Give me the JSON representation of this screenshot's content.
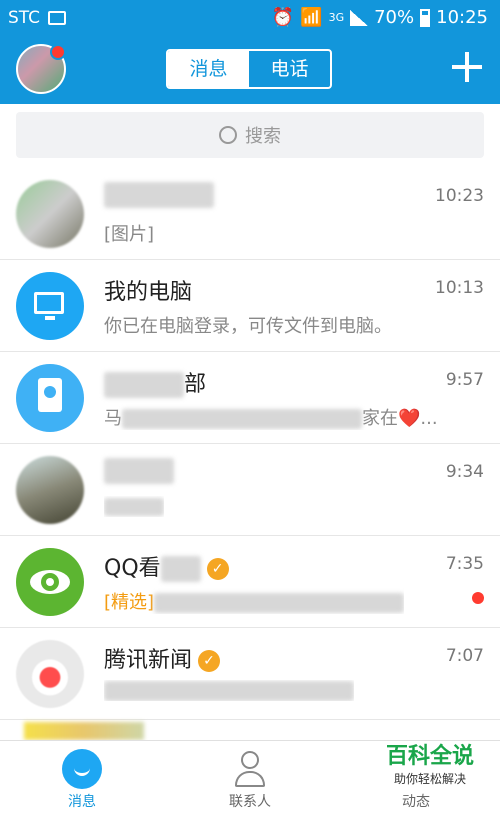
{
  "statusbar": {
    "carrier": "STC",
    "battery": "70%",
    "time": "10:25",
    "network": "3G"
  },
  "header": {
    "tab_messages": "消息",
    "tab_calls": "电话"
  },
  "search": {
    "placeholder": "搜索"
  },
  "chats": [
    {
      "name": "",
      "message": "[图片]",
      "time": "10:23"
    },
    {
      "name": "我的电脑",
      "message": "你已在电脑登录，可传文件到电脑。",
      "time": "10:13"
    },
    {
      "name": "部",
      "message": "马",
      "message_end": "家在❤️...",
      "time": "9:57"
    },
    {
      "name": "",
      "message": "",
      "time": "9:34"
    },
    {
      "name": "QQ看",
      "message": "[精选]",
      "time": "7:35"
    },
    {
      "name": "腾讯新闻",
      "message": "",
      "time": "7:07"
    }
  ],
  "tabbar": {
    "messages": "消息",
    "contacts": "联系人",
    "moments": "动态"
  },
  "watermark": {
    "title": "百科全说",
    "subtitle": "助你轻松解决"
  },
  "colors": {
    "brand": "#1296db",
    "unread": "#ff3b30",
    "verified": "#f5a623",
    "featured": "#f39c12"
  }
}
